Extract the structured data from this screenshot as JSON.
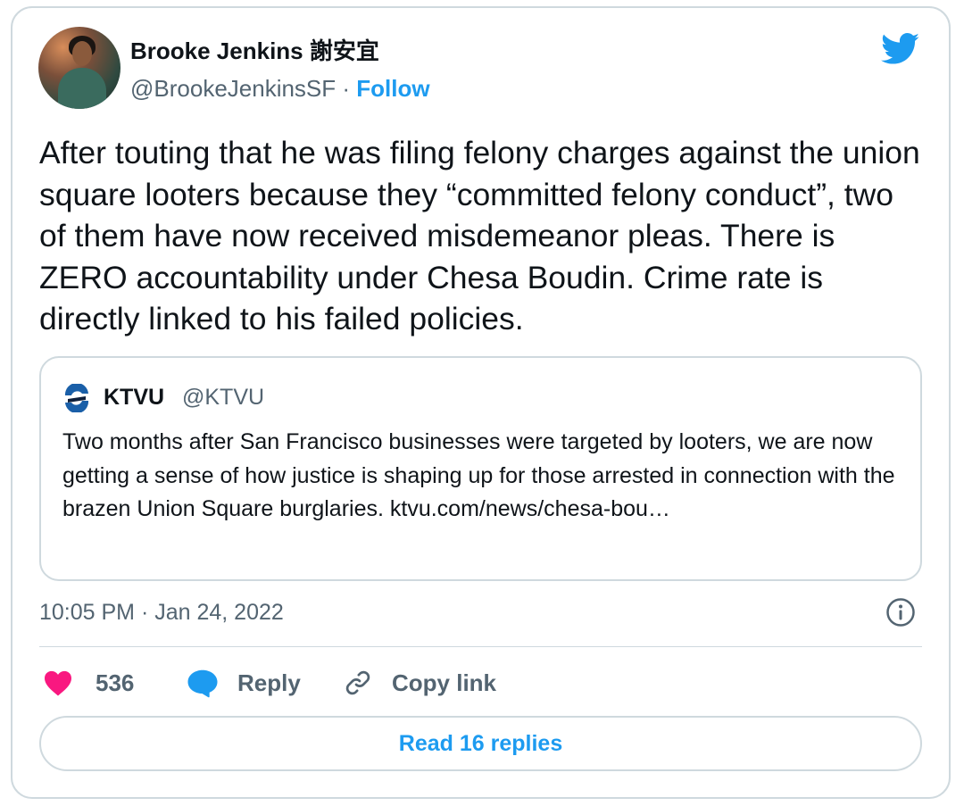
{
  "author": {
    "name": "Brooke Jenkins 謝安宜",
    "handle": "@BrookeJenkinsSF",
    "separator": "·",
    "follow_label": "Follow"
  },
  "tweet": {
    "text": "After touting that he was filing felony charges against the union square looters because they “committed felony conduct”, two of them have now received misdemeanor pleas. There is ZERO accountability under Chesa Boudin. Crime rate is directly linked to his failed policies."
  },
  "quoted_tweet": {
    "name": "KTVU",
    "handle": "@KTVU",
    "text": "Two months after San Francisco businesses were targeted by looters, we are now getting a sense of how justice is shaping up for those arrested in connection with the brazen Union Square burglaries. ktvu.com/news/chesa-bou…"
  },
  "meta": {
    "timestamp": "10:05 PM · Jan 24, 2022"
  },
  "actions": {
    "likes_count": "536",
    "reply_label": "Reply",
    "copy_link_label": "Copy link"
  },
  "read_replies_label": "Read 16 replies",
  "icons": {
    "brand": "twitter-bird-icon",
    "like": "heart-icon",
    "reply": "speech-bubble-icon",
    "copy": "link-icon",
    "info": "info-icon"
  },
  "colors": {
    "accent": "#1d9bf0",
    "like": "#f91880",
    "secondary_text": "#536471",
    "border": "#cfd9de"
  }
}
